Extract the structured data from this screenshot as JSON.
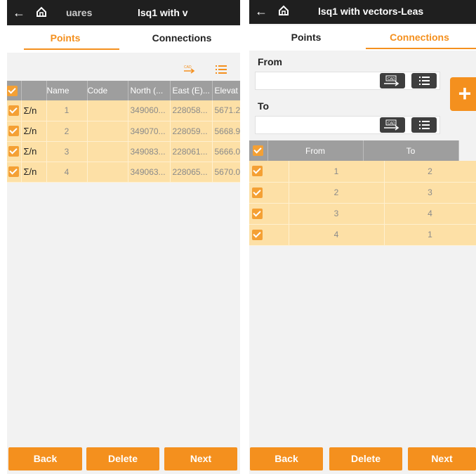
{
  "left": {
    "topbar": {
      "back": "←",
      "subtitle": "uares",
      "title": "lsq1 with v"
    },
    "tabs": [
      {
        "label": "Points"
      },
      {
        "label": "Connections"
      }
    ],
    "columns": [
      "Name",
      "Code",
      "North (...",
      "East (E)...",
      "Elevat"
    ],
    "rows": [
      {
        "sigma": "Σ/n",
        "name": "1",
        "code": "",
        "north": "349060...",
        "east": "228058...",
        "elev": "5671.2"
      },
      {
        "sigma": "Σ/n",
        "name": "2",
        "code": "",
        "north": "349070...",
        "east": "228059...",
        "elev": "5668.9"
      },
      {
        "sigma": "Σ/n",
        "name": "3",
        "code": "",
        "north": "349083...",
        "east": "228061...",
        "elev": "5666.0"
      },
      {
        "sigma": "Σ/n",
        "name": "4",
        "code": "",
        "north": "349063...",
        "east": "228065...",
        "elev": "5670.0"
      }
    ],
    "buttons": {
      "back": "Back",
      "delete": "Delete",
      "next": "Next"
    }
  },
  "right": {
    "topbar": {
      "back": "←",
      "title": "lsq1 with vectors-Leas"
    },
    "tabs": [
      {
        "label": "Points"
      },
      {
        "label": "Connections"
      }
    ],
    "from_label": "From",
    "to_label": "To",
    "from_value": "",
    "to_value": "",
    "fab": "+",
    "columns": [
      "From",
      "To"
    ],
    "rows": [
      {
        "from": "1",
        "to": "2"
      },
      {
        "from": "2",
        "to": "3"
      },
      {
        "from": "3",
        "to": "4"
      },
      {
        "from": "4",
        "to": "1"
      }
    ],
    "buttons": {
      "back": "Back",
      "delete": "Delete",
      "next": "Next"
    }
  },
  "colors": {
    "accent": "#f4901e",
    "row": "#fde0a6",
    "header": "#9e9e9e",
    "topbar": "#1f1f1f"
  }
}
